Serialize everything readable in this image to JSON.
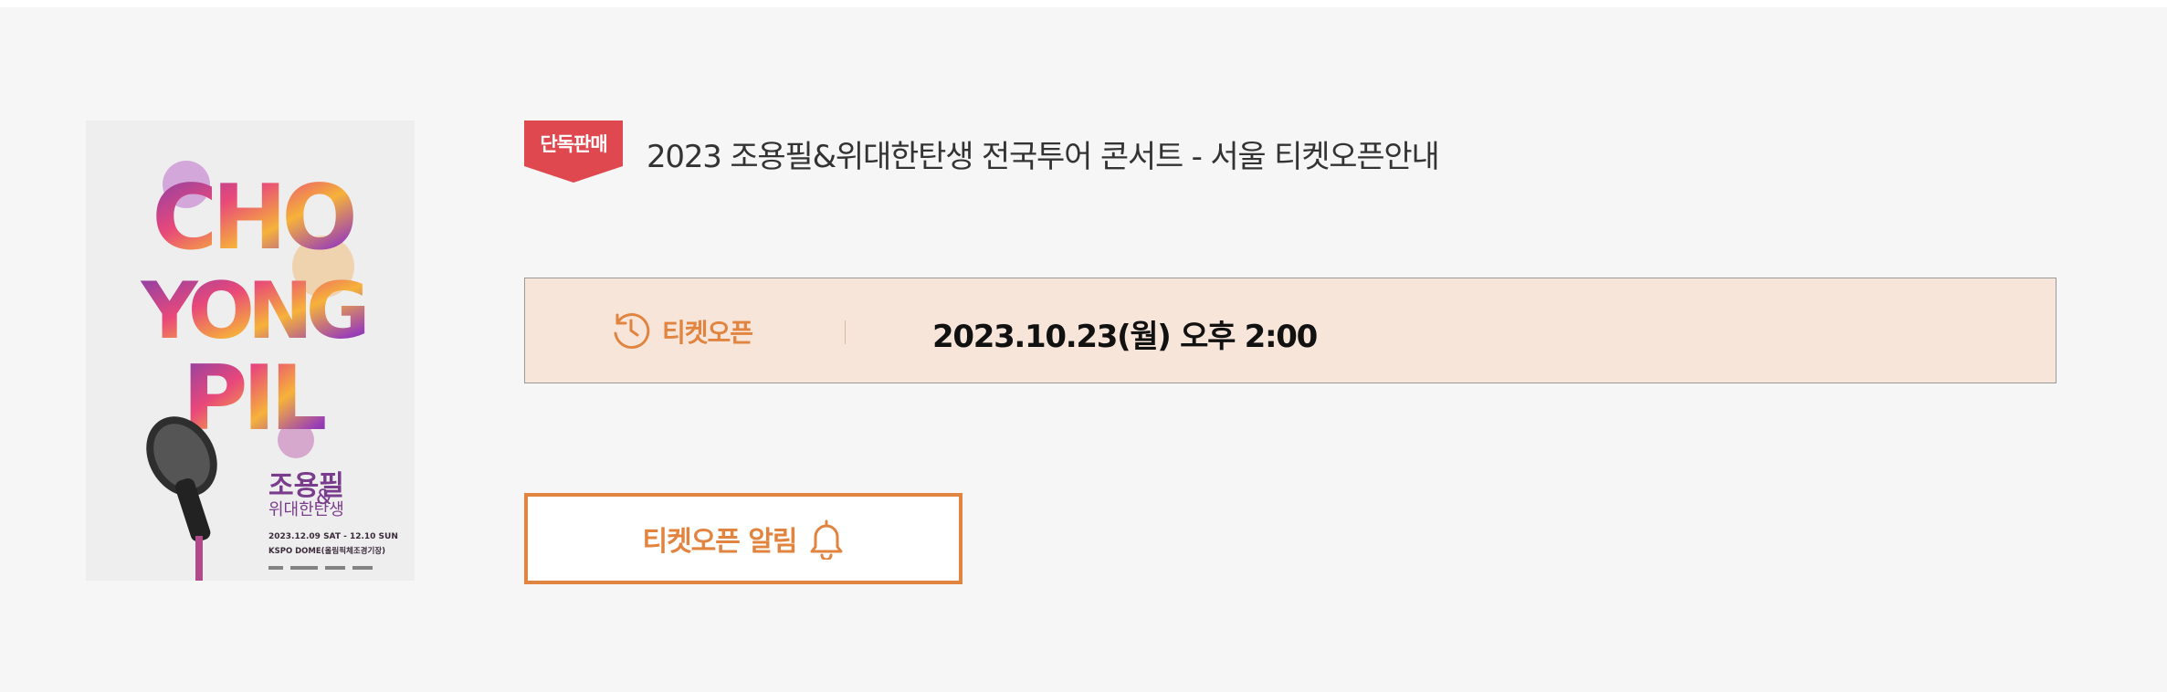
{
  "event": {
    "badge": "단독판매",
    "title": "2023 조용필&위대한탄생 전국투어 콘서트 - 서울 티켓오픈안내"
  },
  "ticket_open": {
    "label": "티켓오픈",
    "datetime": "2023.10.23(월) 오후 2:00"
  },
  "alarm_button": {
    "label": "티켓오픈 알림"
  },
  "poster": {
    "title_lines": [
      "CHO",
      "YONG",
      "PIL"
    ],
    "korean_title": "조용필",
    "amp": "&",
    "korean_subtitle": "위대한탄생",
    "dates": "2023.12.09 SAT - 12.10 SUN",
    "venue": "KSPO DOME(올림픽체조경기장)"
  },
  "colors": {
    "accent": "#e0843f",
    "badge": "#e0484f",
    "open_box_bg": "#f8e5da",
    "background": "#f6f6f6"
  },
  "icons": {
    "open": "history-clock-icon",
    "alarm": "bell-icon"
  }
}
